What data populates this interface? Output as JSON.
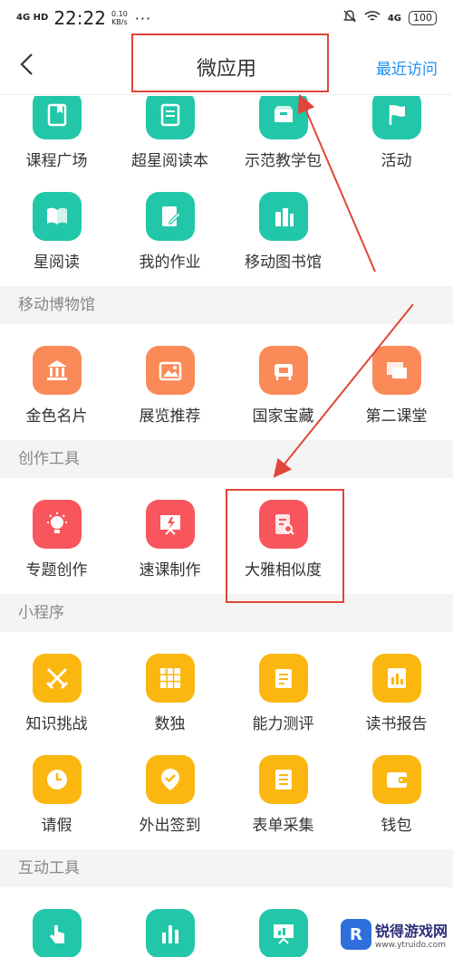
{
  "status_bar": {
    "signal": "4G HD",
    "time": "22:22",
    "speed_value": "0.10",
    "speed_unit": "KB/s",
    "dots": "···",
    "network": "4G",
    "battery": "100"
  },
  "nav": {
    "title": "微应用",
    "recent": "最近访问"
  },
  "sections": [
    {
      "header": "",
      "items": [
        {
          "label": "课程广场",
          "icon": "bookmark-book-icon",
          "color": "#21c7a8"
        },
        {
          "label": "超星阅读本",
          "icon": "reader-icon",
          "color": "#21c7a8"
        },
        {
          "label": "示范教学包",
          "icon": "package-icon",
          "color": "#21c7a8"
        },
        {
          "label": "活动",
          "icon": "flag-icon",
          "color": "#21c7a8"
        },
        {
          "label": "星阅读",
          "icon": "open-book-icon",
          "color": "#21c7a8"
        },
        {
          "label": "我的作业",
          "icon": "edit-note-icon",
          "color": "#21c7a8"
        },
        {
          "label": "移动图书馆",
          "icon": "library-icon",
          "color": "#21c7a8"
        }
      ]
    },
    {
      "header": "移动博物馆",
      "items": [
        {
          "label": "金色名片",
          "icon": "museum-icon",
          "color": "#fb8a59"
        },
        {
          "label": "展览推荐",
          "icon": "picture-frame-icon",
          "color": "#fb8a59"
        },
        {
          "label": "国家宝藏",
          "icon": "treasure-icon",
          "color": "#fb8a59"
        },
        {
          "label": "第二课堂",
          "icon": "classroom-icon",
          "color": "#fb8a59"
        }
      ]
    },
    {
      "header": "创作工具",
      "items": [
        {
          "label": "专题创作",
          "icon": "lightbulb-icon",
          "color": "#f8555c"
        },
        {
          "label": "速课制作",
          "icon": "presentation-bolt-icon",
          "color": "#f8555c"
        },
        {
          "label": "大雅相似度",
          "icon": "document-search-icon",
          "color": "#f8555c"
        }
      ]
    },
    {
      "header": "小程序",
      "items": [
        {
          "label": "知识挑战",
          "icon": "crossed-swords-icon",
          "color": "#fbb710"
        },
        {
          "label": "数独",
          "icon": "sudoku-grid-icon",
          "color": "#fbb710"
        },
        {
          "label": "能力测评",
          "icon": "clipboard-icon",
          "color": "#fbb710"
        },
        {
          "label": "读书报告",
          "icon": "report-book-icon",
          "color": "#fbb710"
        },
        {
          "label": "请假",
          "icon": "clock-icon",
          "color": "#fbb710"
        },
        {
          "label": "外出签到",
          "icon": "location-check-icon",
          "color": "#fbb710"
        },
        {
          "label": "表单采集",
          "icon": "form-icon",
          "color": "#fbb710"
        },
        {
          "label": "钱包",
          "icon": "wallet-icon",
          "color": "#fbb710"
        }
      ]
    },
    {
      "header": "互动工具",
      "items": [
        {
          "label": "",
          "icon": "hand-touch-icon",
          "color": "#21c7a8"
        },
        {
          "label": "",
          "icon": "bar-chart-icon",
          "color": "#21c7a8"
        },
        {
          "label": "",
          "icon": "presentation-icon",
          "color": "#21c7a8"
        }
      ]
    }
  ],
  "watermark": {
    "name": "锐得游戏网",
    "url": "www.ytruido.com"
  }
}
